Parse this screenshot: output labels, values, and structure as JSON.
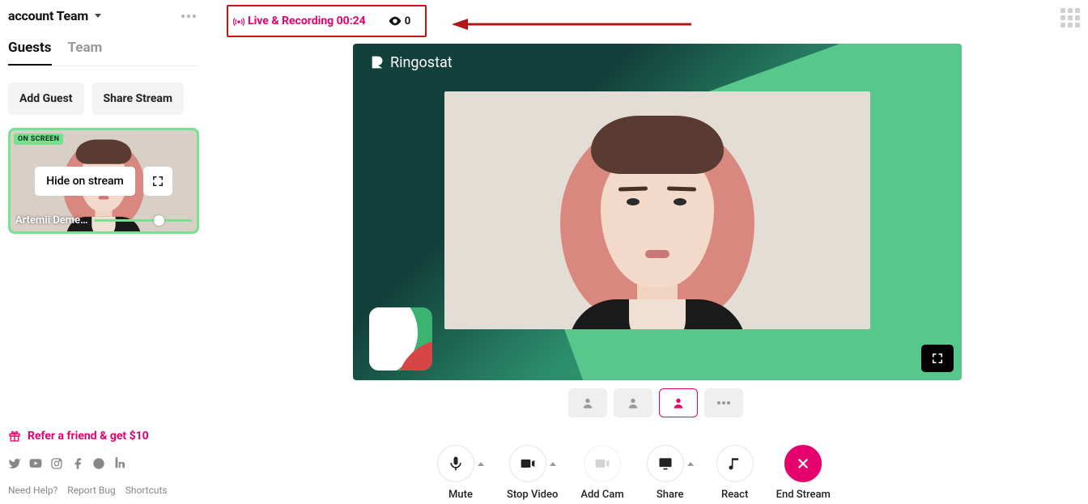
{
  "sidebar": {
    "accountLabel": "account Team",
    "tabs": {
      "guests": "Guests",
      "team": "Team"
    },
    "buttons": {
      "addGuest": "Add Guest",
      "shareStream": "Share Stream"
    },
    "guestCard": {
      "badge": "ON SCREEN",
      "hideLabel": "Hide on stream",
      "name": "Artemii Deme…"
    },
    "referText": "Refer a friend & get $10",
    "footer": {
      "needHelp": "Need Help?",
      "reportBug": "Report Bug",
      "shortcuts": "Shortcuts"
    }
  },
  "status": {
    "liveText": "Live & Recording 00:24",
    "viewerCount": "0"
  },
  "stage": {
    "brandText": "Ringostat"
  },
  "controls": {
    "mute": "Mute",
    "stopVideo": "Stop Video",
    "addCam": "Add Cam",
    "share": "Share",
    "react": "React",
    "endStream": "End Stream"
  }
}
